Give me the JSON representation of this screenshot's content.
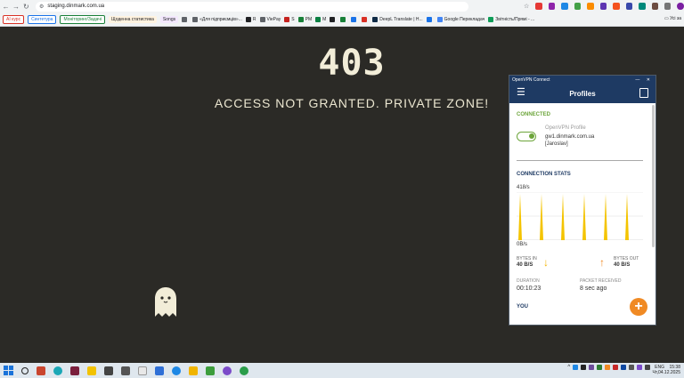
{
  "browser": {
    "url": "staging.dinmark.com.ua",
    "bookmarks": [
      {
        "label": "AI курс",
        "color": "#ffffff",
        "text_color": "#d93025",
        "tag": true
      },
      {
        "label": "Синтетура",
        "color": "#ffffff",
        "text_color": "#1a73e8",
        "tag": true
      },
      {
        "label": "Моніторинг/Задачі",
        "color": "#ffffff",
        "text_color": "#188038",
        "tag": true
      },
      {
        "label": "Щоденна статистика",
        "color": "#fff3e0",
        "text_color": "#202124",
        "tag": true
      },
      {
        "label": "Songs",
        "color": "#f3e8fd",
        "text_color": "#202124",
        "tag": true
      },
      {
        "label": "«Для підприємців»...",
        "icon": "#5f6368"
      },
      {
        "label": "R",
        "icon": "#202124"
      },
      {
        "label": "ViePay",
        "icon": "#5f6368"
      },
      {
        "label": "S",
        "icon": "#c5221f"
      },
      {
        "label": "PM",
        "icon": "#188038"
      },
      {
        "label": "M",
        "icon": "#0b8043"
      },
      {
        "label": "",
        "icon": "#202124"
      },
      {
        "label": "",
        "icon": "#188038"
      },
      {
        "label": "",
        "icon": "#1a73e8"
      },
      {
        "label": "",
        "icon": "#d93025"
      },
      {
        "label": "DeepL Translate | Н...",
        "icon": "#0f2b46"
      },
      {
        "label": "",
        "icon": "#1a73e8"
      },
      {
        "label": "Google Перекладач",
        "icon": "#4285f4"
      },
      {
        "label": "Звітність/Прямі - ...",
        "icon": "#0f9d58"
      }
    ],
    "bookmarks_overflow": "Усі за"
  },
  "page": {
    "code": "403",
    "message": "ACCESS NOT GRANTED. PRIVATE ZONE!"
  },
  "vpn": {
    "app_title": "OpenVPN Connect",
    "window_controls": "— ✕",
    "header_title": "Profiles",
    "status": "CONNECTED",
    "profile_name": "OpenVPN Profile",
    "profile_host": "gw1.dinmark.com.ua",
    "profile_user": "[Jaroslav]",
    "stats_label": "CONNECTION STATS",
    "rate_top": "418/s",
    "rate_bottom": "0B/s",
    "bytes_in_label": "BYTES IN",
    "bytes_in_value": "40 B/S",
    "bytes_out_label": "BYTES OUT",
    "bytes_out_value": "40 B/S",
    "duration_label": "DURATION",
    "duration_value": "00:10:23",
    "packet_label": "PACKET RECEIVED",
    "packet_value": "8 sec ago",
    "you_label": "YOU",
    "add_label": "+",
    "colors": {
      "accent": "#f08a24",
      "navy": "#1e3a63",
      "green": "#6da53b",
      "spike": "#f4c400"
    },
    "spike_values": [
      1,
      1,
      1,
      1,
      1,
      1
    ]
  },
  "taskbar": {
    "lang": "ENG",
    "time": "15:38",
    "date": "Чт,04.12.2025"
  }
}
